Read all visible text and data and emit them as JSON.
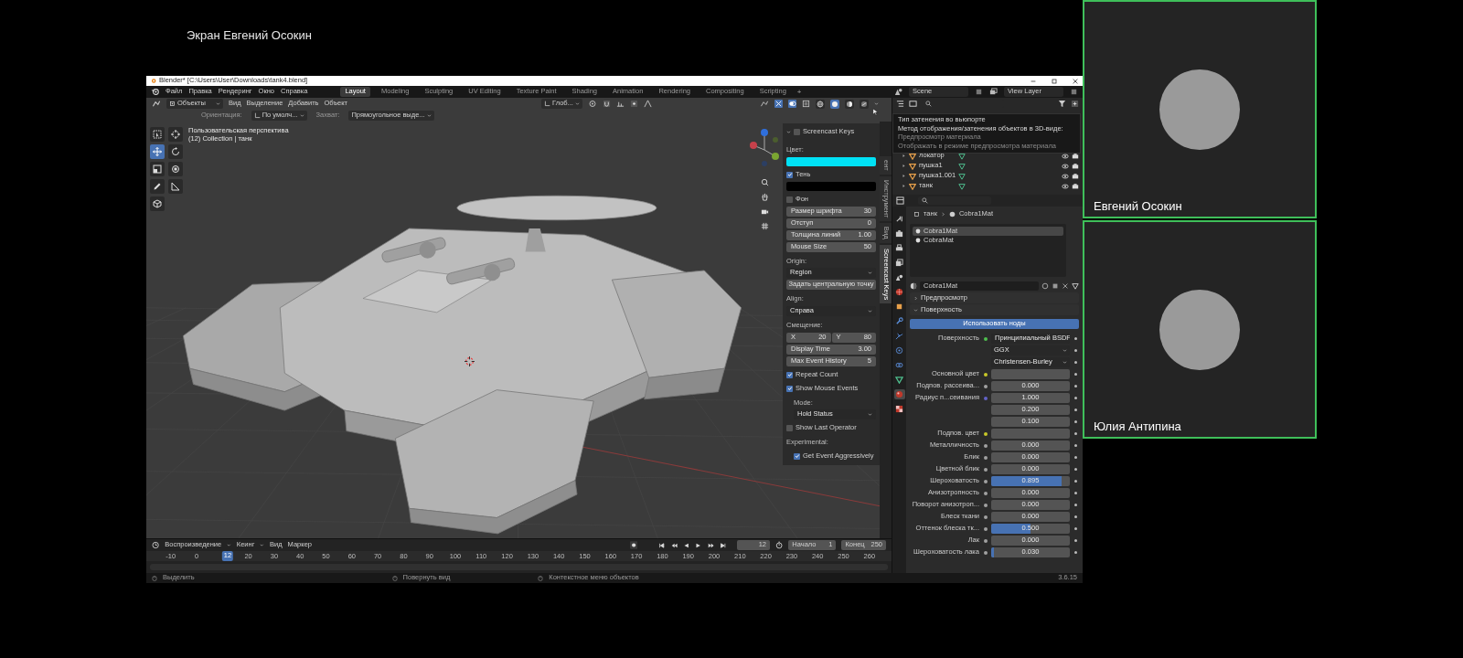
{
  "meeting": {
    "screen_title": "Экран Евгений Осокин",
    "participants": [
      {
        "name": "Евгений Осокин"
      },
      {
        "name": "Юлия Антипина"
      }
    ]
  },
  "blender": {
    "window_title": "Blender* [C:\\Users\\User\\Downloads\\tank4.blend]",
    "menus": [
      "Файл",
      "Правка",
      "Рендеринг",
      "Окно",
      "Справка"
    ],
    "workspaces": [
      {
        "label": "Layout",
        "selected": true
      },
      {
        "label": "Modeling",
        "selected": false
      },
      {
        "label": "Sculpting",
        "selected": false
      },
      {
        "label": "UV Editing",
        "selected": false
      },
      {
        "label": "Texture Paint",
        "selected": false
      },
      {
        "label": "Shading",
        "selected": false
      },
      {
        "label": "Animation",
        "selected": false
      },
      {
        "label": "Rendering",
        "selected": false
      },
      {
        "label": "Compositing",
        "selected": false
      },
      {
        "label": "Scripting",
        "selected": false
      }
    ],
    "add_workspace": "+",
    "scene": "Scene",
    "view_layer": "View Layer",
    "viewport_header": {
      "mode": "Объекты",
      "menus": [
        "Вид",
        "Выделение",
        "Добавить",
        "Объект"
      ],
      "transform_orientation": "Глоб..."
    },
    "shading_modes": [
      {
        "kind": "wireframe",
        "selected": false
      },
      {
        "kind": "solid",
        "selected": true
      },
      {
        "kind": "material",
        "selected": false
      },
      {
        "kind": "rendered",
        "selected": false
      }
    ],
    "tool_settings": [
      {
        "label": "Ориентация:",
        "value": "По умолч..."
      },
      {
        "label": "Захват:",
        "value": "Прямоугольное выде..."
      }
    ],
    "tools": [
      {
        "kind": "select",
        "selected": false
      },
      {
        "kind": "cursor",
        "selected": false
      },
      {
        "kind": "move",
        "selected": true
      },
      {
        "kind": "rotate",
        "selected": false
      },
      {
        "kind": "scale",
        "selected": false
      },
      {
        "kind": "transform",
        "selected": false
      },
      {
        "kind": "annotate",
        "selected": false
      },
      {
        "kind": "measure",
        "selected": false
      },
      {
        "kind": "add_cube",
        "selected": false
      }
    ],
    "viewport": {
      "view_name": "Пользовательская перспектива",
      "collection": "(12) Collection | танк"
    },
    "sidebar": {
      "tabs": [
        {
          "label": "ент",
          "selected": false
        },
        {
          "label": "Инструмент",
          "selected": false
        },
        {
          "label": "Вид",
          "selected": false
        },
        {
          "label": "Screencast Keys",
          "selected": true
        }
      ],
      "panel": {
        "title": "Screencast Keys",
        "checked": false,
        "items": [
          {
            "kind": "label",
            "text": "Цвет:"
          },
          {
            "kind": "color",
            "color": "#00e1f5"
          },
          {
            "kind": "checkbox",
            "text": "Тень",
            "checked": true
          },
          {
            "kind": "color",
            "color": "#000000"
          },
          {
            "kind": "checkbox",
            "text": "Фон",
            "checked": false
          },
          {
            "kind": "number",
            "text": "Размер шрифта",
            "value": "30"
          },
          {
            "kind": "number",
            "text": "Отступ",
            "value": "0"
          },
          {
            "kind": "number",
            "text": "Толщина линий",
            "value": "1.00"
          },
          {
            "kind": "number",
            "text": "Mouse Size",
            "value": "50"
          },
          {
            "kind": "label",
            "text": "Origin:"
          },
          {
            "kind": "dropdown",
            "value": "Region"
          },
          {
            "kind": "button",
            "text": "Задать центральную точку"
          },
          {
            "kind": "label",
            "text": "Align:"
          },
          {
            "kind": "dropdown",
            "value": "Справа"
          },
          {
            "kind": "label",
            "text": "Смещение:"
          },
          {
            "kind": "pair",
            "fields": [
              {
                "text": "X",
                "value": "20"
              },
              {
                "text": "Y",
                "value": "80"
              }
            ]
          },
          {
            "kind": "number",
            "text": "Display Time",
            "value": "3.00"
          },
          {
            "kind": "number",
            "text": "Max Event History",
            "value": "5"
          },
          {
            "kind": "checkbox",
            "text": "Repeat Count",
            "checked": true
          },
          {
            "kind": "checkbox",
            "text": "Show Mouse Events",
            "checked": true,
            "children": [
              {
                "kind": "label",
                "text": "Mode:"
              },
              {
                "kind": "dropdown",
                "value": "Hold Status"
              }
            ]
          },
          {
            "kind": "checkbox",
            "text": "Show Last Operator",
            "checked": false
          },
          {
            "kind": "label",
            "text": "Experimental:",
            "children": [
              {
                "kind": "checkbox",
                "text": "Get Event Aggressively",
                "checked": true
              }
            ]
          }
        ]
      }
    },
    "tooltip": {
      "title": "Тип затенения во вьюпорте",
      "description": "Метод отображения/затенения объектов в 3D-виде:",
      "value": "Предпросмотр материала",
      "hint": "Отображать в режиме предпросмотра материала"
    },
    "outliner": {
      "items": [
        {
          "name": "локатор"
        },
        {
          "name": "пушка1"
        },
        {
          "name": "пушка1.001"
        },
        {
          "name": "танк"
        }
      ]
    },
    "properties": {
      "tabs": [
        {
          "kind": "tool",
          "selected": false
        },
        {
          "kind": "render",
          "selected": false
        },
        {
          "kind": "output",
          "selected": false
        },
        {
          "kind": "view_layer",
          "selected": false
        },
        {
          "kind": "scene",
          "selected": false
        },
        {
          "kind": "world",
          "selected": false
        },
        {
          "kind": "object",
          "selected": false
        },
        {
          "kind": "modifiers",
          "selected": false
        },
        {
          "kind": "particles",
          "selected": false
        },
        {
          "kind": "physics",
          "selected": false
        },
        {
          "kind": "constraints",
          "selected": false
        },
        {
          "kind": "data",
          "selected": false
        },
        {
          "kind": "material",
          "selected": true
        },
        {
          "kind": "texture",
          "selected": false
        }
      ],
      "breadcrumb": [
        "танк",
        "Cobra1Mat"
      ],
      "slots": [
        {
          "name": "Cobra1Mat",
          "selected": true
        },
        {
          "name": "CobraMat",
          "selected": false
        }
      ],
      "material": "Cobra1Mat",
      "sections": [
        {
          "title": "Предпросмотр",
          "expanded": false
        },
        {
          "title": "Поверхность",
          "expanded": true
        }
      ],
      "use_nodes": "Использовать ноды",
      "rows": [
        {
          "kind": "link",
          "text": "Поверхность",
          "value": "Принципиальный BSDF",
          "color": "#4fc04f"
        },
        {
          "kind": "dropdown",
          "value": "GGX"
        },
        {
          "kind": "dropdown",
          "value": "Christensen-Burley"
        },
        {
          "kind": "color",
          "text": "Основной цвет",
          "color": "#c7c729"
        },
        {
          "kind": "number",
          "text": "Подпов. рассеива...",
          "value": "0.000",
          "level": 0,
          "color": "#a1a1a1"
        },
        {
          "kind": "vector",
          "text": "Радиус п...сеивания",
          "values": [
            "1.000",
            "0.200",
            "0.100"
          ],
          "color": "#6363c7"
        },
        {
          "kind": "color",
          "text": "Подпов. цвет",
          "color": "#c7c729"
        },
        {
          "kind": "number",
          "text": "Металличность",
          "value": "0.000",
          "level": 0,
          "color": "#a1a1a1"
        },
        {
          "kind": "number",
          "text": "Блик",
          "value": "0.000",
          "level": 0,
          "color": "#a1a1a1"
        },
        {
          "kind": "number",
          "text": "Цветной блик",
          "value": "0.000",
          "level": 0,
          "color": "#a1a1a1"
        },
        {
          "kind": "number",
          "text": "Шероховатость",
          "value": "0.895",
          "level": 0.895,
          "color": "#a1a1a1"
        },
        {
          "kind": "number",
          "text": "Анизотропность",
          "value": "0.000",
          "level": 0,
          "color": "#a1a1a1"
        },
        {
          "kind": "number",
          "text": "Поворот анизотроп...",
          "value": "0.000",
          "level": 0,
          "color": "#a1a1a1"
        },
        {
          "kind": "number",
          "text": "Блеск ткани",
          "value": "0.000",
          "level": 0,
          "color": "#a1a1a1"
        },
        {
          "kind": "number",
          "text": "Оттенок блеска тк...",
          "value": "0.500",
          "level": 0.5,
          "color": "#a1a1a1"
        },
        {
          "kind": "number",
          "text": "Лак",
          "value": "0.000",
          "level": 0,
          "color": "#a1a1a1"
        },
        {
          "kind": "number",
          "text": "Шероховатость лака",
          "value": "0.030",
          "level": 0.03,
          "color": "#a1a1a1"
        }
      ]
    },
    "timeline": {
      "menus": [
        "Воспроизведение",
        "Кеинг",
        "Вид",
        "Маркер"
      ],
      "current_frame": "12",
      "start_label": "Начало",
      "start": "1",
      "end_label": "Конец",
      "end": "250",
      "ticks": [
        "-10",
        "0",
        "20",
        "30",
        "40",
        "50",
        "60",
        "70",
        "80",
        "90",
        "100",
        "110",
        "120",
        "130",
        "140",
        "150",
        "160",
        "170",
        "180",
        "190",
        "200",
        "210",
        "220",
        "230",
        "240",
        "250",
        "260"
      ],
      "playhead": "12"
    },
    "status_bar": {
      "items": [
        "Выделить",
        "Повернуть вид",
        "Контекстное меню объектов"
      ],
      "version": "3.6.15"
    }
  }
}
